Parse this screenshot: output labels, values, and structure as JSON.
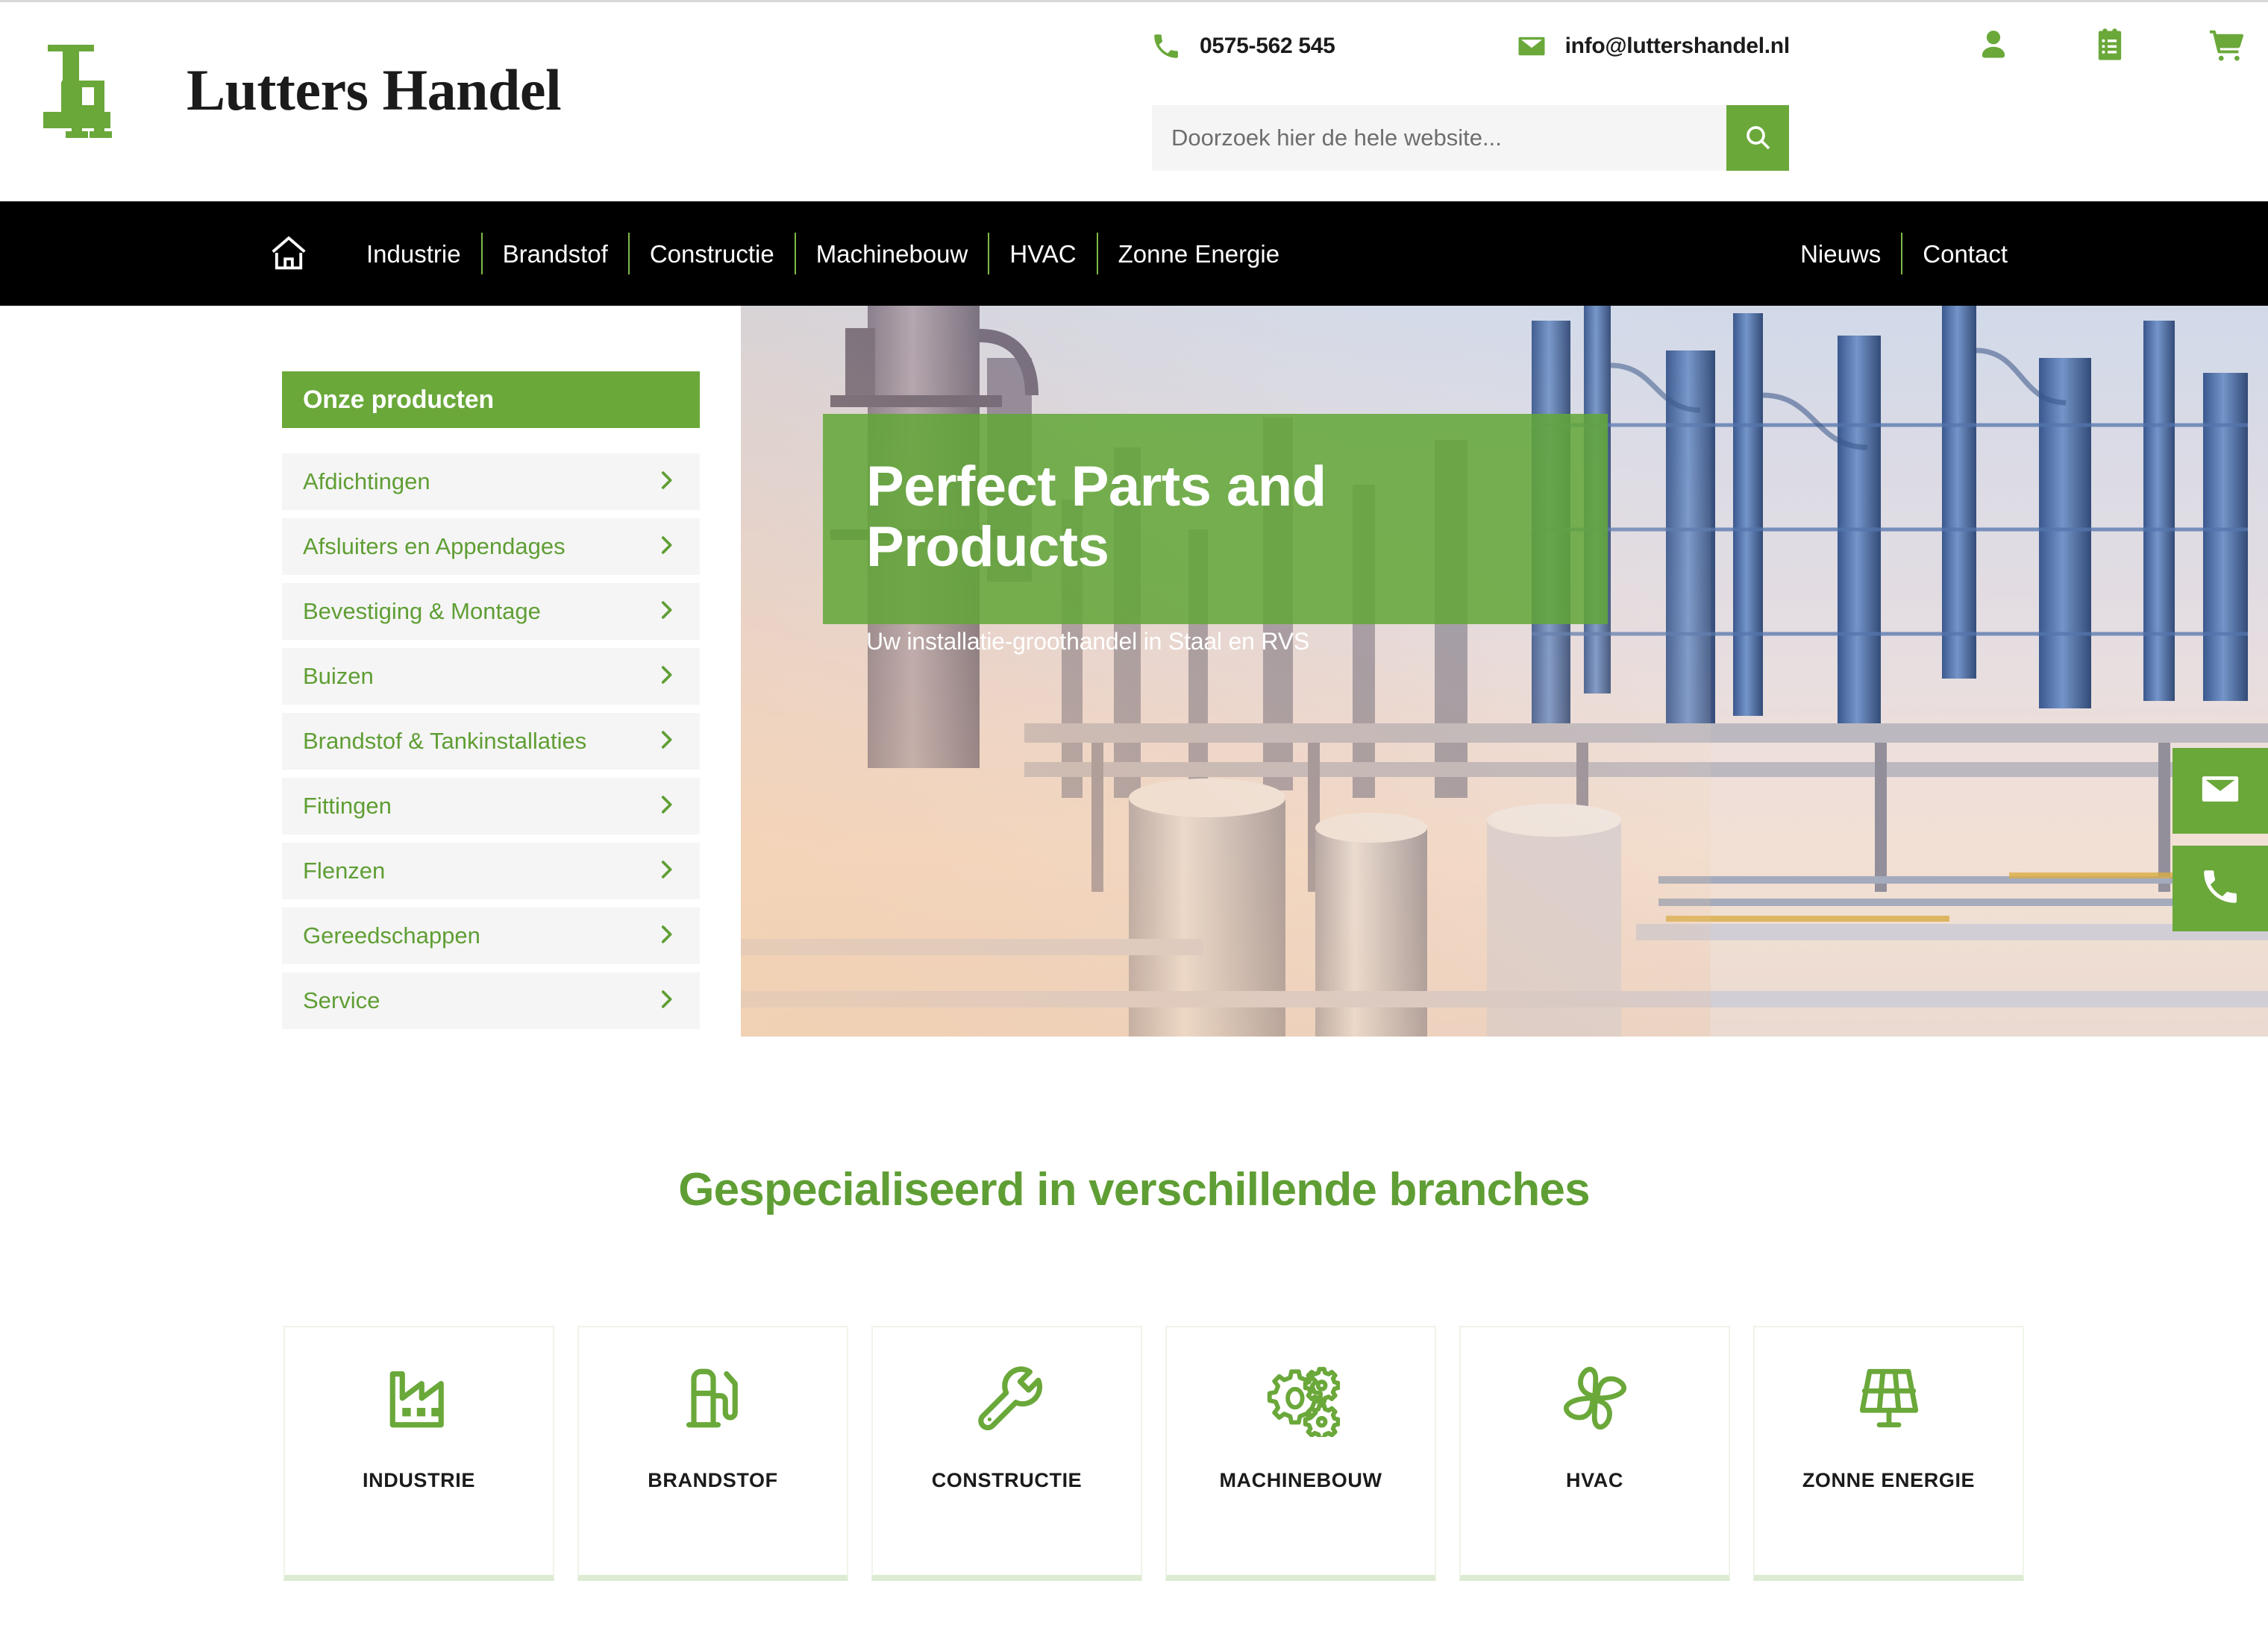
{
  "brand": {
    "logo_text": "Lutters Handel",
    "logo_mark": "lh-monogram",
    "accent_green": "#6aa83a",
    "nav_bg": "#000000"
  },
  "header": {
    "phone_icon": "phone-icon",
    "phone": "0575-562 545",
    "email_icon": "envelope-icon",
    "email": "info@luttershandel.nl",
    "icons": [
      {
        "name": "account-icon",
        "glyph": "user"
      },
      {
        "name": "quote-list-icon",
        "glyph": "clipboard"
      },
      {
        "name": "cart-icon",
        "glyph": "shopping-cart"
      }
    ],
    "search": {
      "placeholder": "Doorzoek hier de hele website...",
      "value": "",
      "button_icon": "search-icon"
    }
  },
  "nav": {
    "home_icon": "home-icon",
    "left_items": [
      {
        "label": "Industrie"
      },
      {
        "label": "Brandstof"
      },
      {
        "label": "Constructie"
      },
      {
        "label": "Machinebouw"
      },
      {
        "label": "HVAC"
      },
      {
        "label": "Zonne Energie"
      }
    ],
    "right_items": [
      {
        "label": "Nieuws"
      },
      {
        "label": "Contact"
      }
    ]
  },
  "sidebar": {
    "heading": "Onze producten",
    "chevron_icon": "chevron-right-icon",
    "items": [
      {
        "label": "Afdichtingen"
      },
      {
        "label": "Afsluiters en Appendages"
      },
      {
        "label": "Bevestiging & Montage"
      },
      {
        "label": "Buizen"
      },
      {
        "label": "Brandstof & Tankinstallaties"
      },
      {
        "label": "Fittingen"
      },
      {
        "label": "Flenzen"
      },
      {
        "label": "Gereedschappen"
      },
      {
        "label": "Service"
      }
    ]
  },
  "hero": {
    "title_line1": "Perfect Parts and",
    "title_line2": "Products",
    "subtitle": "Uw installatie-groothandel in Staal en RVS",
    "image_alt": "industrial refinery plant piping"
  },
  "float_buttons": [
    {
      "name": "email-float-button",
      "icon": "envelope-icon"
    },
    {
      "name": "phone-float-button",
      "icon": "phone-icon"
    }
  ],
  "branches": {
    "title": "Gespecialiseerd in verschillende branches",
    "cards": [
      {
        "label": "INDUSTRIE",
        "icon": "factory-icon"
      },
      {
        "label": "BRANDSTOF",
        "icon": "fuel-pump-icon"
      },
      {
        "label": "CONSTRUCTIE",
        "icon": "wrench-icon"
      },
      {
        "label": "MACHINEBOUW",
        "icon": "gears-icon"
      },
      {
        "label": "HVAC",
        "icon": "fan-icon"
      },
      {
        "label": "ZONNE ENERGIE",
        "icon": "solar-panel-icon"
      }
    ]
  }
}
